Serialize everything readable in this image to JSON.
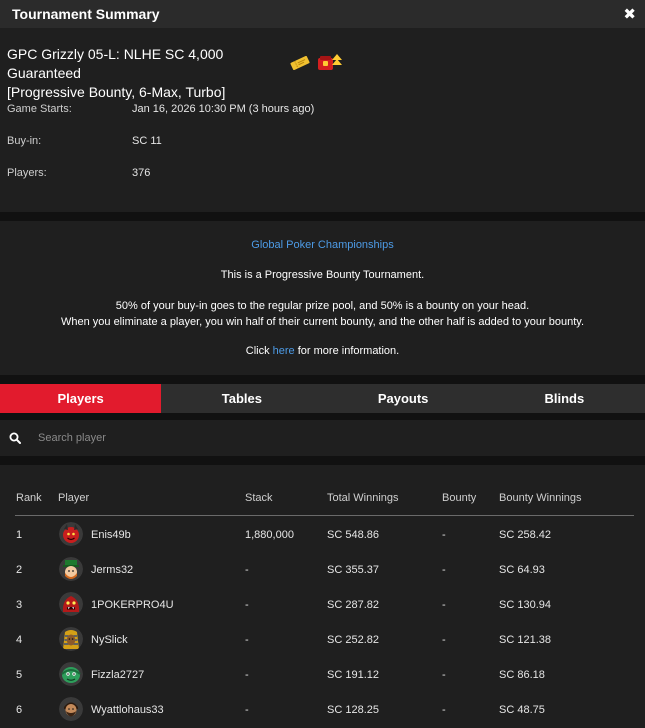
{
  "header": {
    "title": "Tournament Summary",
    "close": "✖"
  },
  "tournament": {
    "name_line1": "GPC Grizzly 05-L: NLHE SC 4,000 Guaranteed",
    "name_line2": "[Progressive Bounty, 6-Max, Turbo]",
    "details": [
      {
        "label": "Game Starts:",
        "value": "Jan 16, 2026 10:30 PM (3 hours ago)"
      },
      {
        "label": "Buy-in:",
        "value": "SC 11"
      },
      {
        "label": "Players:",
        "value": "376"
      }
    ]
  },
  "info": {
    "series_link": "Global Poker Championships",
    "line1": "This is a Progressive Bounty Tournament.",
    "line2": "50% of your buy-in goes to the regular prize pool, and 50% is a bounty on your head.",
    "line3": "When you eliminate a player, you win half of their current bounty, and the other half is added to your bounty.",
    "click_prefix": "Click ",
    "click_link": "here",
    "click_suffix": " for more information."
  },
  "tabs": [
    {
      "label": "Players",
      "active": true
    },
    {
      "label": "Tables",
      "active": false
    },
    {
      "label": "Payouts",
      "active": false
    },
    {
      "label": "Blinds",
      "active": false
    }
  ],
  "search": {
    "placeholder": "Search player"
  },
  "table": {
    "columns": [
      "Rank",
      "Player",
      "Stack",
      "Total Winnings",
      "Bounty",
      "Bounty Winnings"
    ],
    "rows": [
      {
        "rank": "1",
        "player": "Enis49b",
        "stack": "1,880,000",
        "total": "SC 548.86",
        "bounty": "-",
        "bounty_winnings": "SC 258.42",
        "avatar": "red-devil-avatar"
      },
      {
        "rank": "2",
        "player": "Jerms32",
        "stack": "-",
        "total": "SC 355.37",
        "bounty": "-",
        "bounty_winnings": "SC 64.93",
        "avatar": "leprechaun-avatar"
      },
      {
        "rank": "3",
        "player": "1POKERPRO4U",
        "stack": "-",
        "total": "SC 287.82",
        "bounty": "-",
        "bounty_winnings": "SC 130.94",
        "avatar": "red-monster-avatar"
      },
      {
        "rank": "4",
        "player": "NySlick",
        "stack": "-",
        "total": "SC 252.82",
        "bounty": "-",
        "bounty_winnings": "SC 121.38",
        "avatar": "pharaoh-avatar"
      },
      {
        "rank": "5",
        "player": "Fizzla2727",
        "stack": "-",
        "total": "SC 191.12",
        "bounty": "-",
        "bounty_winnings": "SC 86.18",
        "avatar": "green-creature-avatar"
      },
      {
        "rank": "6",
        "player": "Wyattlohaus33",
        "stack": "-",
        "total": "SC 128.25",
        "bounty": "-",
        "bounty_winnings": "SC 48.75",
        "avatar": "bearded-man-avatar"
      }
    ]
  },
  "colors": {
    "accent": "#e21b2d",
    "link": "#4d9be6",
    "background": "#111111",
    "panel": "#1f1f1f",
    "header": "#2b2b2b"
  },
  "icons": [
    "close-icon",
    "ticket-icon",
    "bounty-icon",
    "search-icon"
  ]
}
